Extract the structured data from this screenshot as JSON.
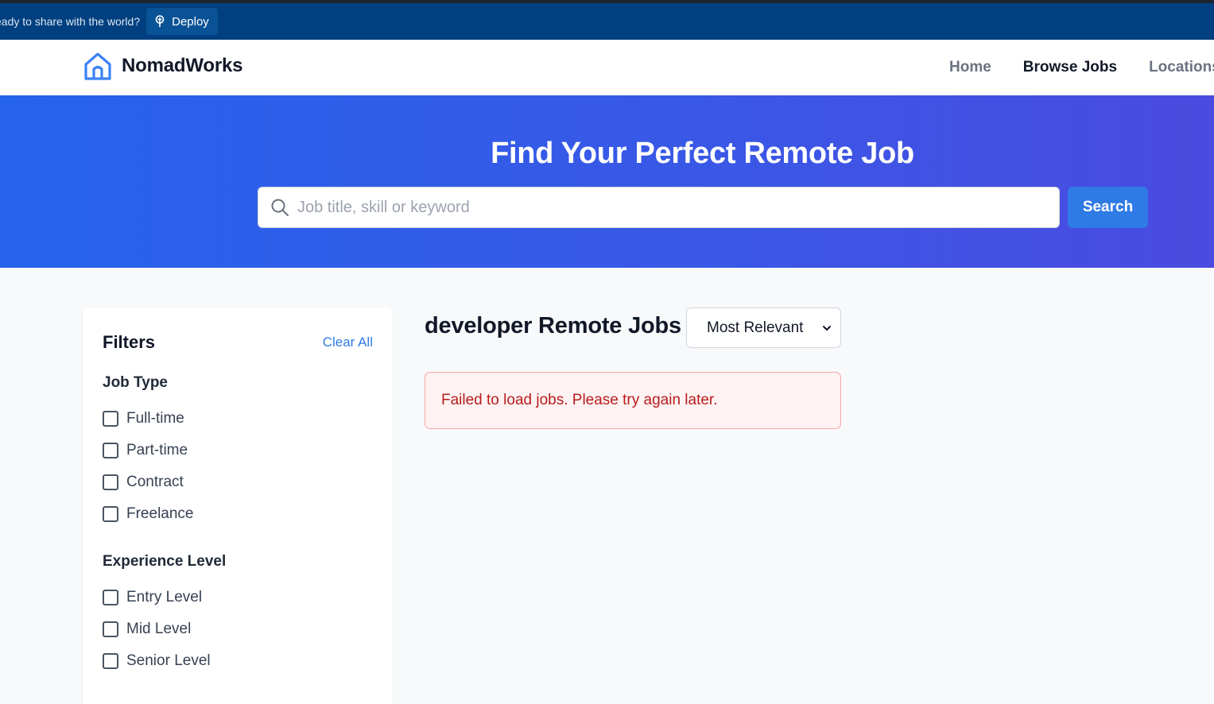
{
  "deploy_bar": {
    "prompt": "eady to share with the world?",
    "button_label": "Deploy"
  },
  "navbar": {
    "brand": "NomadWorks",
    "links": [
      {
        "label": "Home",
        "active": false
      },
      {
        "label": "Browse Jobs",
        "active": true
      },
      {
        "label": "Locations",
        "active": false
      }
    ]
  },
  "hero": {
    "title": "Find Your Perfect Remote Job",
    "search_placeholder": "Job title, skill or keyword",
    "search_value": "",
    "search_button": "Search"
  },
  "filters": {
    "title": "Filters",
    "clear_label": "Clear All",
    "job_type": {
      "title": "Job Type",
      "options": [
        "Full-time",
        "Part-time",
        "Contract",
        "Freelance"
      ]
    },
    "experience": {
      "title": "Experience Level",
      "options": [
        "Entry Level",
        "Mid Level",
        "Senior Level"
      ]
    }
  },
  "results": {
    "title": "developer Remote Jobs",
    "sort_selected": "Most Relevant",
    "error_message": "Failed to load jobs. Please try again later."
  },
  "colors": {
    "deploy_bar": "#004080",
    "accent": "#2f7be6",
    "hero_start": "#2563eb",
    "hero_end": "#4b4be0",
    "error_text": "#b91c1c",
    "error_bg": "#fef2f2"
  }
}
